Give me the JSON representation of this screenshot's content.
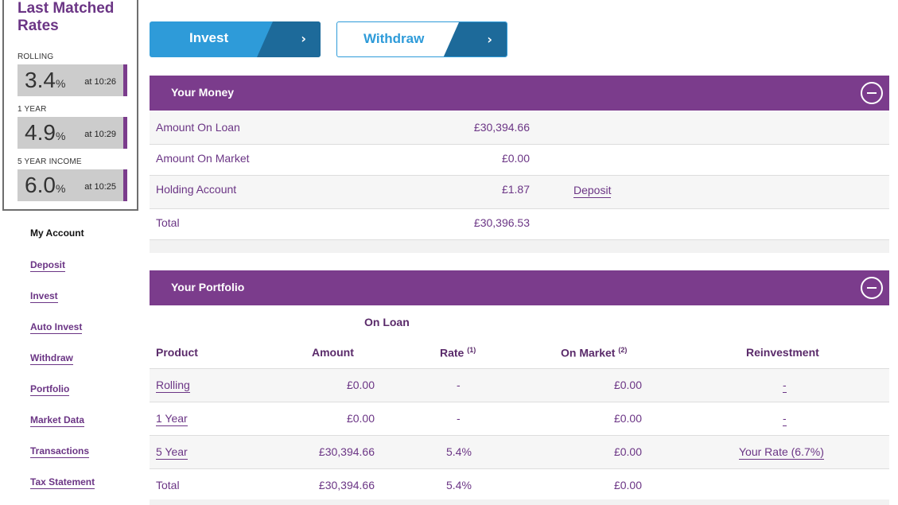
{
  "rates": {
    "title": "Last Matched Rates",
    "items": [
      {
        "label": "ROLLING",
        "value": "3.4",
        "unit": "%",
        "time": "at 10:26"
      },
      {
        "label": "1 YEAR",
        "value": "4.9",
        "unit": "%",
        "time": "at 10:29"
      },
      {
        "label": "5 YEAR INCOME",
        "value": "6.0",
        "unit": "%",
        "time": "at 10:25"
      }
    ]
  },
  "nav": {
    "heading": "My Account",
    "items": [
      "Deposit",
      "Invest",
      "Auto Invest",
      "Withdraw",
      "Portfolio",
      "Market Data",
      "Transactions",
      "Tax Statement"
    ]
  },
  "actions": {
    "invest_label": "Invest",
    "withdraw_label": "Withdraw",
    "arrow": "›"
  },
  "money": {
    "title": "Your Money",
    "rows": [
      {
        "label": "Amount On Loan",
        "amount": "£30,394.66",
        "link": ""
      },
      {
        "label": "Amount On Market",
        "amount": "£0.00",
        "link": ""
      },
      {
        "label": "Holding Account",
        "amount": "£1.87",
        "link": "Deposit"
      },
      {
        "label": "Total",
        "amount": "£30,396.53",
        "link": ""
      }
    ]
  },
  "portfolio": {
    "title": "Your Portfolio",
    "group_header": "On Loan",
    "columns": {
      "product": "Product",
      "amount": "Amount",
      "rate": "Rate",
      "rate_note": "(1)",
      "on_market": "On Market",
      "on_market_note": "(2)",
      "reinvestment": "Reinvestment"
    },
    "rows": [
      {
        "product": "Rolling",
        "amount": "£0.00",
        "rate": "-",
        "on_market": "£0.00",
        "reinvestment": "-"
      },
      {
        "product": "1 Year",
        "amount": "£0.00",
        "rate": "-",
        "on_market": "£0.00",
        "reinvestment": "-"
      },
      {
        "product": "5 Year",
        "amount": "£30,394.66",
        "rate": "5.4%",
        "on_market": "£0.00",
        "reinvestment": "Your Rate (6.7%)"
      },
      {
        "product": "Total",
        "amount": "£30,394.66",
        "rate": "5.4%",
        "on_market": "£0.00",
        "reinvestment": ""
      }
    ]
  },
  "colors": {
    "brand_purple": "#7b3c8c",
    "invest_blue": "#2e9bd9",
    "arrow_blue": "#1d6a9a"
  }
}
